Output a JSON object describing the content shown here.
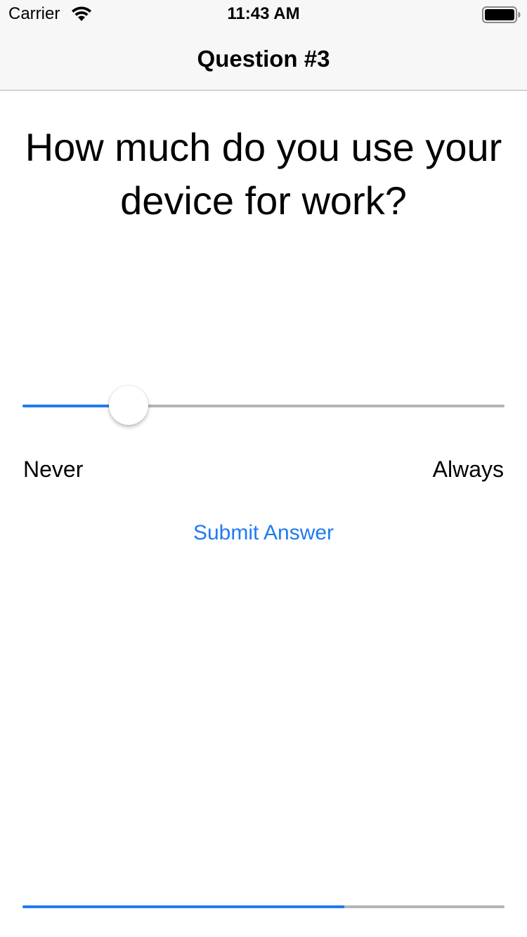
{
  "status_bar": {
    "carrier": "Carrier",
    "time": "11:43 AM",
    "wifi_icon": "wifi-icon",
    "battery_icon": "battery-icon",
    "battery_level": 1.0
  },
  "nav": {
    "title": "Question #3"
  },
  "question": {
    "text": "How much do you use your device for work?"
  },
  "slider": {
    "value": 0.22,
    "min_label": "Never",
    "max_label": "Always",
    "fill_color": "#1f7cf0",
    "track_color": "#b5b5b5"
  },
  "submit": {
    "label": "Submit Answer",
    "color": "#1f7cf0"
  },
  "progress": {
    "value": 0.667
  }
}
